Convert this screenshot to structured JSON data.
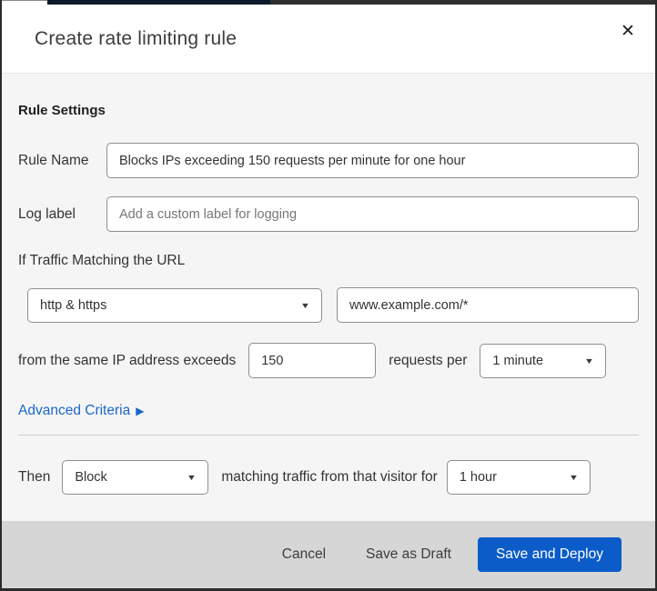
{
  "dialog": {
    "title": "Create rate limiting rule"
  },
  "icons": {
    "close": "✕",
    "caret_down": "▼",
    "arrow_right": "▶"
  },
  "form": {
    "section_heading": "Rule Settings",
    "rule_name": {
      "label": "Rule Name",
      "value": "Blocks IPs exceeding 150 requests per minute for one hour"
    },
    "log_label": {
      "label": "Log label",
      "placeholder": "Add a custom label for logging"
    },
    "traffic_match": {
      "heading": "If Traffic Matching the URL",
      "scheme_value": "http & https",
      "url_value": "www.example.com/*"
    },
    "threshold": {
      "prefix": "from the same IP address exceeds",
      "requests_value": "150",
      "middle": "requests per",
      "period_value": "1 minute"
    },
    "advanced_criteria": "Advanced Criteria",
    "action": {
      "prefix": "Then",
      "action_value": "Block",
      "middle": "matching traffic from that visitor for",
      "duration_value": "1 hour"
    }
  },
  "footer": {
    "cancel": "Cancel",
    "save_draft": "Save as Draft",
    "save_deploy": "Save and Deploy"
  },
  "colors": {
    "primary_button_blue": "#0b5cc9",
    "link_blue": "#1b67cc",
    "footer_bg": "#d6d6d6",
    "body_bg": "#f5f5f5",
    "top_strip_navy": "#0b1b2b",
    "frame_dark": "#2b2b2b"
  }
}
